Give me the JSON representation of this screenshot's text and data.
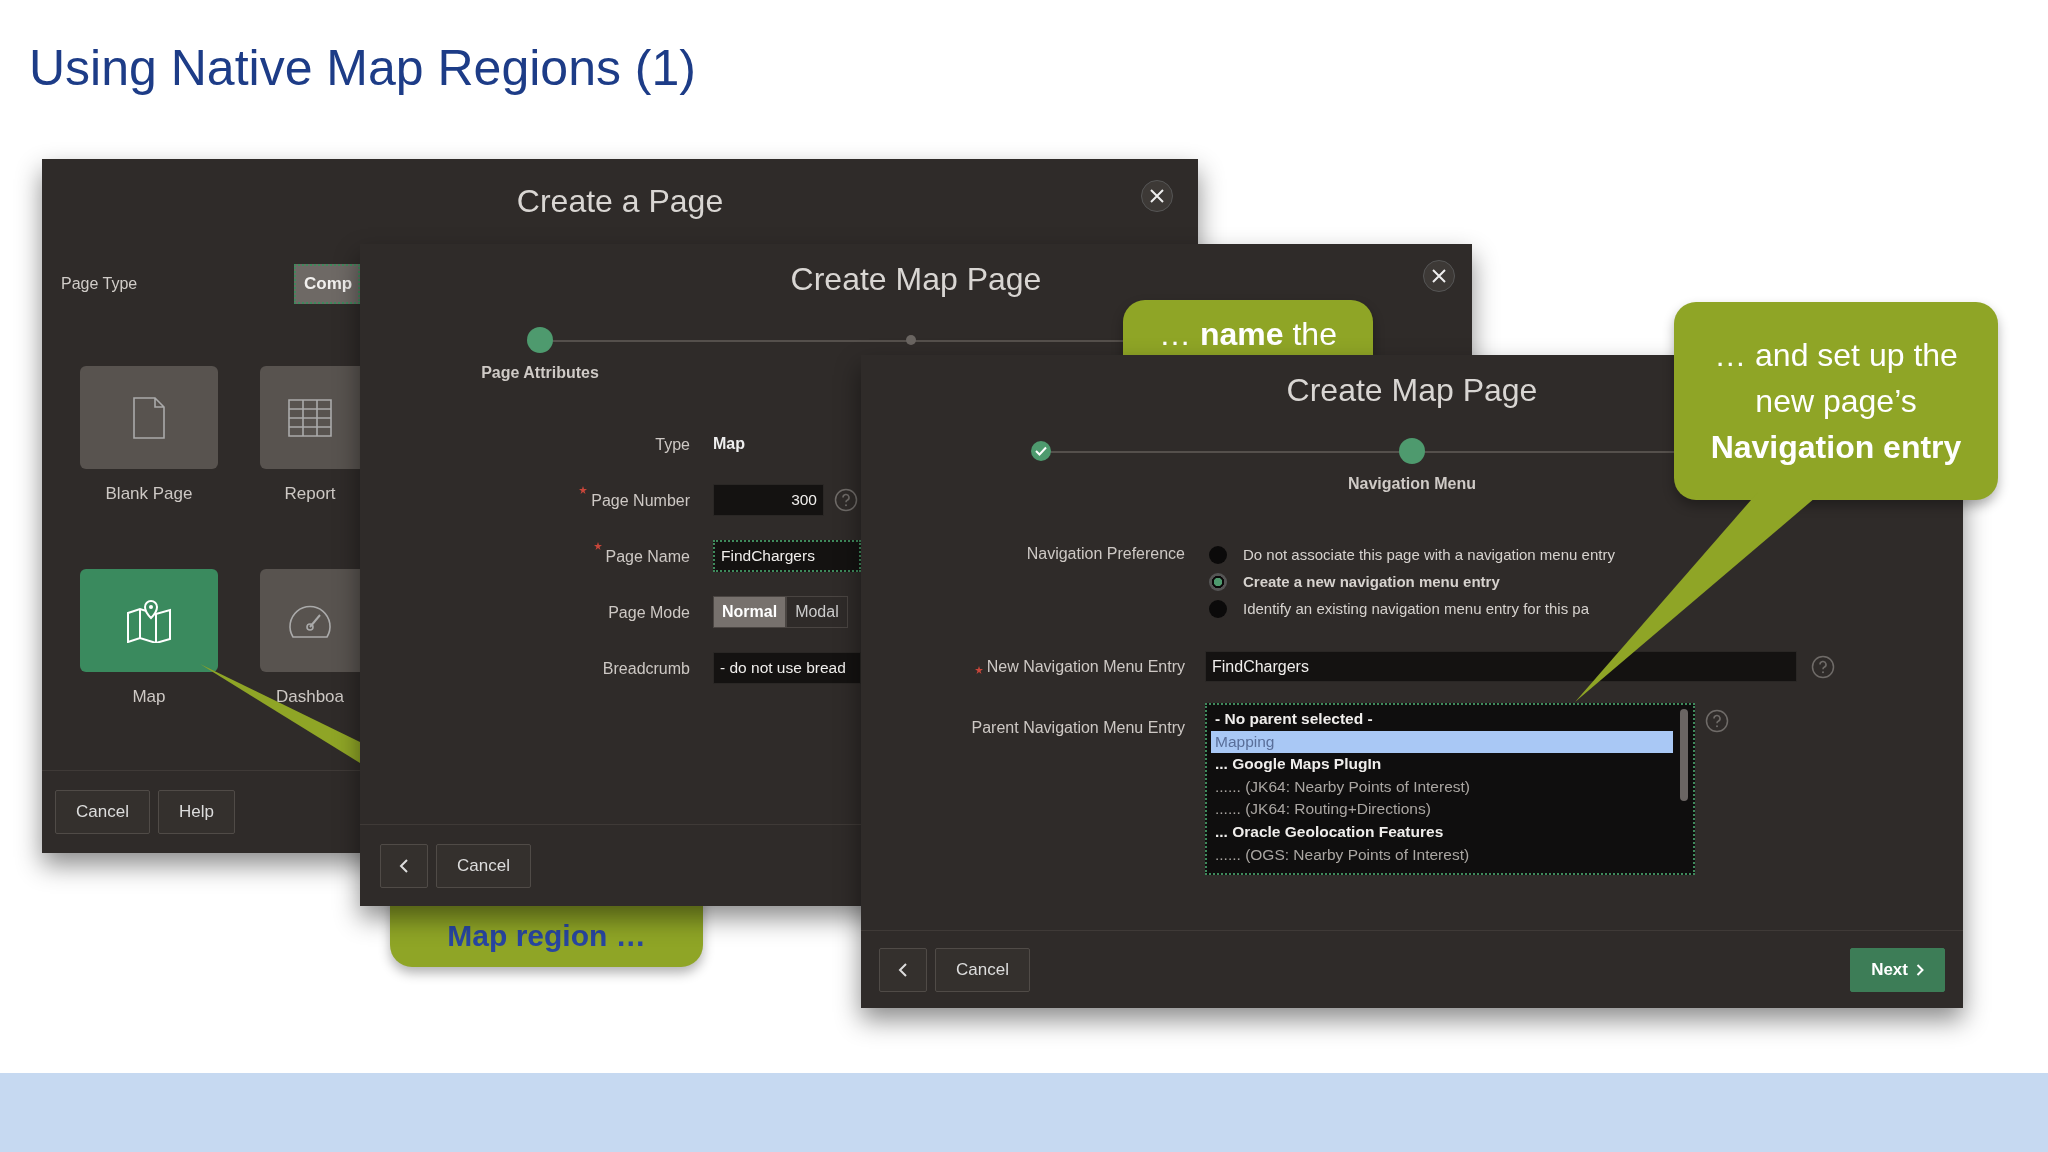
{
  "slide": {
    "title": "Using Native Map Regions (1)"
  },
  "page_type_dialog": {
    "title": "Create a Page",
    "page_type_label": "Page Type",
    "page_type_button": {
      "label": "Comp",
      "focused": true
    },
    "tiles": [
      {
        "kind": "page",
        "label": "Blank Page",
        "selected": false
      },
      {
        "kind": "table",
        "label": "Report",
        "selected": false
      },
      {
        "kind": "map",
        "label": "Map",
        "selected": true
      },
      {
        "kind": "gauge",
        "label": "Dashboa",
        "selected": false
      }
    ],
    "buttons": [
      "Cancel",
      "Help"
    ]
  },
  "attributes_dialog": {
    "title": "Create Map Page",
    "steps": [
      {
        "label": "Page Attributes",
        "kind": "current"
      },
      {
        "kind": "upcoming"
      }
    ],
    "fields": [
      {
        "kind": "static",
        "label": "Type",
        "value": "Map"
      },
      {
        "kind": "number",
        "label": "Page Number",
        "value": "300",
        "required": true,
        "help": true
      },
      {
        "kind": "text",
        "label": "Page Name",
        "value": "FindChargers",
        "required": true,
        "focused": true
      },
      {
        "kind": "segmented",
        "label": "Page Mode",
        "options": [
          {
            "label": "Normal",
            "selected": true
          },
          {
            "label": "Modal",
            "selected": false
          }
        ]
      },
      {
        "kind": "select",
        "label": "Breadcrumb",
        "value": "- do not use bread"
      }
    ],
    "buttons": [
      {
        "kind": "back"
      },
      {
        "kind": "plain",
        "label": "Cancel"
      }
    ]
  },
  "navigation_dialog": {
    "title": "Create Map Page",
    "steps": [
      {
        "kind": "complete"
      },
      {
        "label": "Navigation Menu",
        "kind": "current"
      }
    ],
    "navigation_preference": {
      "label": "Navigation Preference",
      "options": [
        {
          "label": "Do not associate this page with a navigation menu entry",
          "selected": false
        },
        {
          "label": "Create a new navigation menu entry",
          "selected": true
        },
        {
          "label": "Identify an existing navigation menu entry for this pa",
          "selected": false
        }
      ]
    },
    "new_entry": {
      "label": "New Navigation Menu Entry",
      "value": "FindChargers",
      "required": true,
      "help": true
    },
    "parent_entry": {
      "label": "Parent Navigation Menu Entry",
      "focused": true,
      "help": true,
      "items": [
        {
          "label": "- No parent selected -",
          "selected": false
        },
        {
          "label": "Mapping",
          "selected": true,
          "children": [
            {
              "label": "... Google Maps PlugIn",
              "selected": false,
              "children": [
                {
                  "label": "...... (JK64: Nearby Points of Interest)",
                  "selected": false
                },
                {
                  "label": "...... (JK64: Routing+Directions)",
                  "selected": false
                }
              ]
            },
            {
              "label": "... Oracle Geolocation Features",
              "selected": false,
              "children": [
                {
                  "label": "...... (OGS: Nearby Points of Interest)",
                  "selected": false
                }
              ]
            }
          ]
        }
      ]
    },
    "buttons": [
      {
        "kind": "back"
      },
      {
        "kind": "plain",
        "label": "Cancel"
      },
      {
        "kind": "primary",
        "label": "Next"
      }
    ]
  },
  "callouts": [
    {
      "text": "… **name** the",
      "color": "#ffffff"
    },
    {
      "text": "… and set up the new page’s **Navigation entry**",
      "color": "#ffffff"
    },
    {
      "text": "Map region …",
      "color": "#2846a0"
    }
  ]
}
